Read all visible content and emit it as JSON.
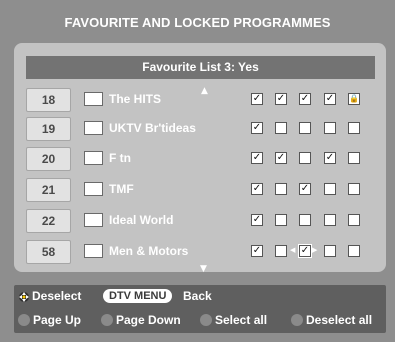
{
  "title": "FAVOURITE AND LOCKED PROGRAMMES",
  "list_header": "Favourite List 3: Yes",
  "checkbox_glyphs": {
    "checked": "✓",
    "empty": "",
    "lock": "🔒"
  },
  "rows": [
    {
      "number": "18",
      "name": "The HITS",
      "boxes": [
        "checked",
        "checked",
        "checked",
        "checked",
        "lock"
      ]
    },
    {
      "number": "19",
      "name": "UKTV Br'tideas",
      "boxes": [
        "checked",
        "empty",
        "empty",
        "empty",
        "empty"
      ]
    },
    {
      "number": "20",
      "name": "F tn",
      "boxes": [
        "checked",
        "checked",
        "empty",
        "checked",
        "empty"
      ]
    },
    {
      "number": "21",
      "name": "TMF",
      "boxes": [
        "checked",
        "empty",
        "checked",
        "empty",
        "empty"
      ]
    },
    {
      "number": "22",
      "name": "Ideal World",
      "boxes": [
        "checked",
        "empty",
        "empty",
        "empty",
        "empty"
      ]
    },
    {
      "number": "58",
      "name": "Men & Motors",
      "boxes": [
        "checked",
        "empty",
        "checked",
        "empty",
        "empty"
      ]
    }
  ],
  "focused": {
    "row": 5,
    "col": 2
  },
  "footer": {
    "deselect": "Deselect",
    "dtv_menu": "DTV MENU",
    "back": "Back",
    "page_up": "Page Up",
    "page_down": "Page Down",
    "select_all": "Select all",
    "deselect_all": "Deselect all"
  },
  "colors": {
    "background": "#8e8e8e",
    "panel": "#c3c3c3",
    "header_bar": "#737373",
    "footer": "#5f5f5f"
  }
}
